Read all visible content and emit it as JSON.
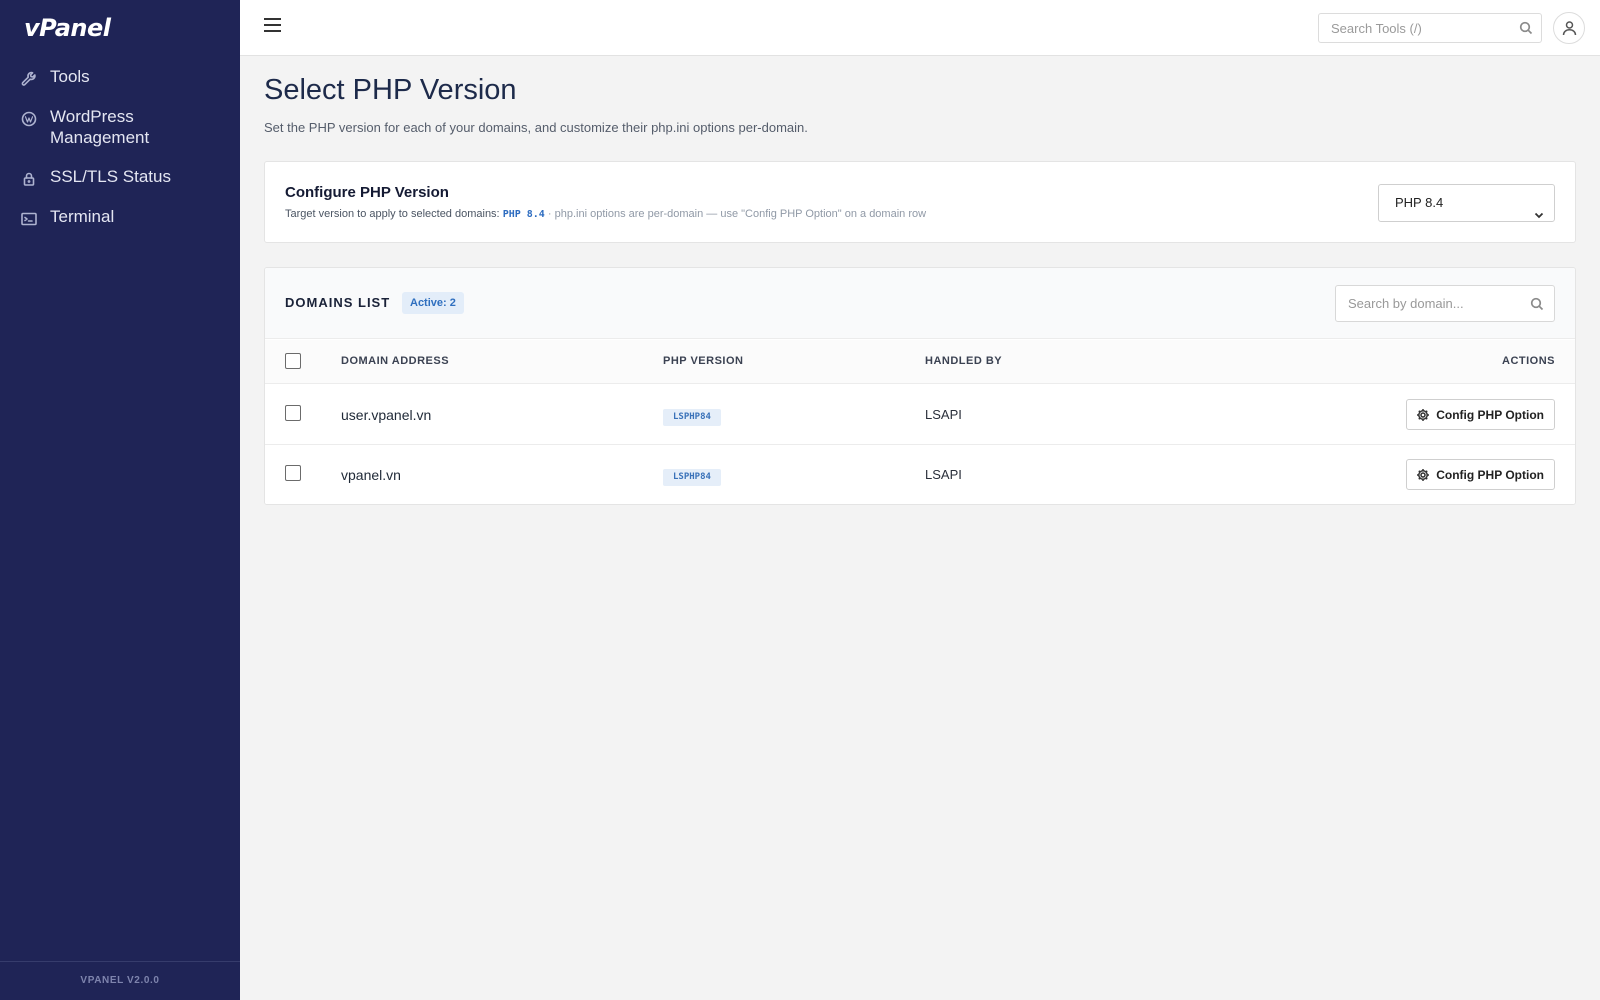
{
  "app": {
    "logo": "vPanel",
    "version": "VPANEL V2.0.0"
  },
  "sidebar": {
    "items": [
      {
        "label": "Tools",
        "icon": "wrench-icon"
      },
      {
        "label": "WordPress Management",
        "icon": "wordpress-icon"
      },
      {
        "label": "SSL/TLS Status",
        "icon": "lock-icon"
      },
      {
        "label": "Terminal",
        "icon": "terminal-icon"
      }
    ]
  },
  "topbar": {
    "search_placeholder": "Search Tools (/)"
  },
  "page": {
    "title": "Select PHP Version",
    "subtitle": "Set the PHP version for each of your domains, and customize their php.ini options per-domain."
  },
  "config": {
    "title": "Configure PHP Version",
    "desc_label": "Target version to apply to selected domains:",
    "target_version": "PHP 8.4",
    "desc_note": "· php.ini options are per-domain — use \"Config PHP Option\" on a domain row",
    "selected_version": "PHP 8.4"
  },
  "domains": {
    "title": "DOMAINS LIST",
    "active_badge": "Active: 2",
    "search_placeholder": "Search by domain...",
    "columns": {
      "domain": "DOMAIN ADDRESS",
      "php_version": "PHP VERSION",
      "handled_by": "HANDLED BY",
      "actions": "ACTIONS"
    },
    "rows": [
      {
        "domain": "user.vpanel.vn",
        "php": "LSPHP84",
        "handler": "LSAPI",
        "action": "Config PHP Option"
      },
      {
        "domain": "vpanel.vn",
        "php": "LSPHP84",
        "handler": "LSAPI",
        "action": "Config PHP Option"
      }
    ]
  },
  "colors": {
    "sidebar_bg": "#1f2456",
    "accent": "#2f6fbf",
    "page_bg": "#f3f3f3"
  }
}
